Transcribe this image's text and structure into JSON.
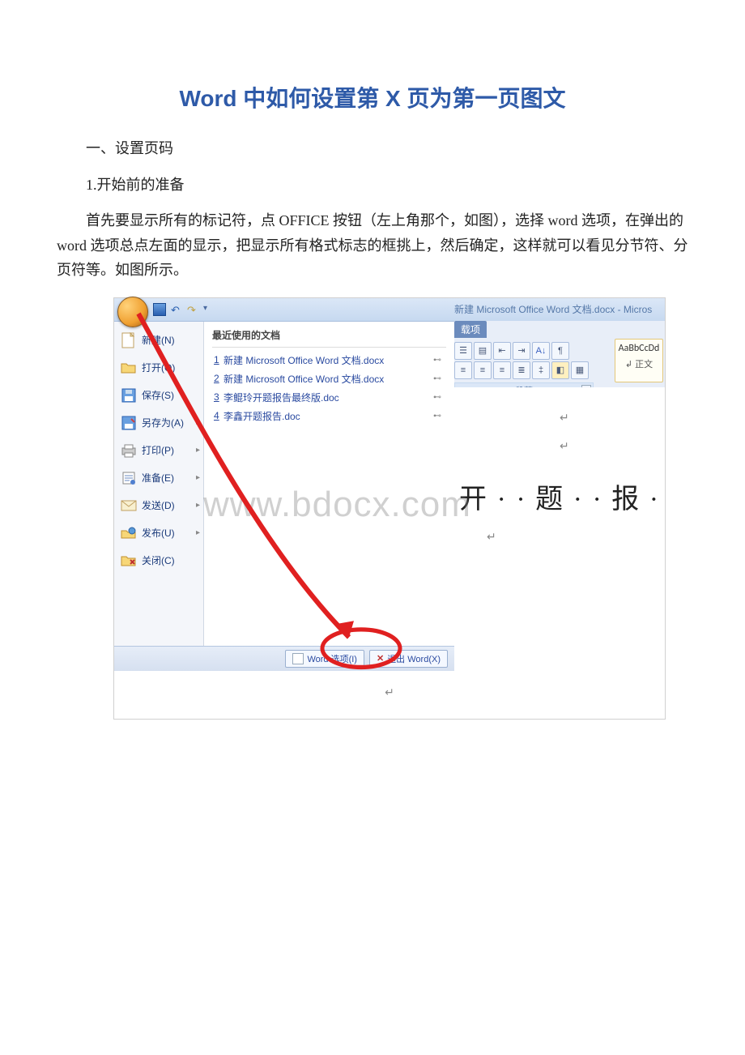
{
  "title": "Word 中如何设置第 X 页为第一页图文",
  "section1": "一、设置页码",
  "step1": "1.开始前的准备",
  "para1": "首先要显示所有的标记符，点 OFFICE 按钮（左上角那个，如图），选择 word 选项，在弹出的 word 选项总点左面的显示，把显示所有格式标志的框挑上，然后确定，这样就可以看见分节符、分页符等。如图所示。",
  "window_title": "新建 Microsoft Office Word 文档.docx - Micros",
  "ribbon_tab": "载项",
  "ribbon_group": "段落",
  "style_sample": "AaBbCcDd",
  "style_name": "↲ 正文",
  "recent_header": "最近使用的文档",
  "menu": {
    "new": "新建(N)",
    "open": "打开(O)",
    "save": "保存(S)",
    "saveas": "另存为(A)",
    "print": "打印(P)",
    "prepare": "准备(E)",
    "send": "发送(D)",
    "publish": "发布(U)",
    "close": "关闭(C)"
  },
  "recent": [
    {
      "n": "1",
      "name": "新建 Microsoft Office Word 文档.docx"
    },
    {
      "n": "2",
      "name": "新建 Microsoft Office Word 文档.docx"
    },
    {
      "n": "3",
      "name": "李鲲玲开题报告最终版.doc"
    },
    {
      "n": "4",
      "name": "李鑫开题报告.doc"
    }
  ],
  "footer_options": "Word 选项(I)",
  "footer_exit": "退出 Word(X)",
  "body_big": "开 · · 题 · · 报 · ·",
  "watermark": "www.bdocx.com",
  "pmark": "↵"
}
